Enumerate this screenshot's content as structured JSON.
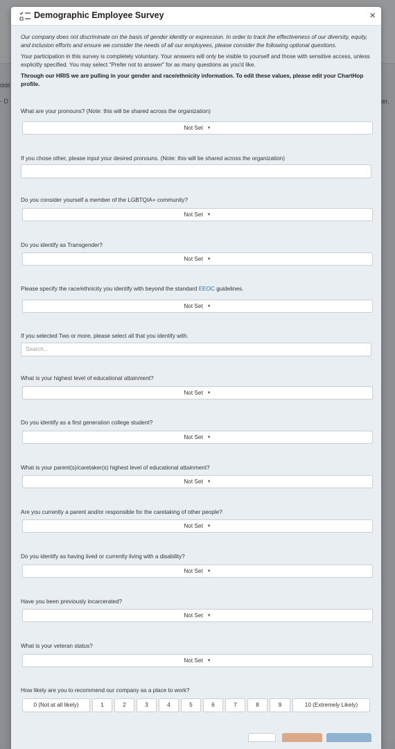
{
  "background": {
    "left_text_1": "ddit",
    "left_text_2": "- D",
    "right_text": "aker,"
  },
  "modal": {
    "title": "Demographic Employee Survey",
    "close_symbol": "×",
    "title_icon": "checklist-icon"
  },
  "intro": {
    "paragraph1": "Our company does not discriminate on the basis of gender identity or expression. In order to track the effectiveness of our diversity, equity, and inclusion efforts and ensure we consider the needs of all our employees, please consider the following optional questions.",
    "paragraph2": "Your participation in this survey is completely voluntary. Your answers will only be visible to yourself and those with sensitive access, unless explicitly specified. You may select \"Prefer not to answer\" for as many questions as you'd like.",
    "paragraph3": "Through our HRIS we are pulling in your gender and race/ethnicity information. To edit these values, please edit your ChartHop profile."
  },
  "questions": {
    "pronouns": {
      "label": "What are your pronouns? (Note: this will be shared across the organization)",
      "value": "Not Set"
    },
    "pronouns_other": {
      "label": "If you chose other, please input your desired pronouns. (Note: this will be shared across the organization)",
      "value": ""
    },
    "lgbtqia": {
      "label": "Do you consider yourself a member of the LGBTQIA+ community?",
      "value": "Not Set"
    },
    "transgender": {
      "label": "Do you identify as Transgender?",
      "value": "Not Set"
    },
    "race": {
      "label_before": "Please specify the race/ethnicity you identify with beyond the standard ",
      "label_link": "EEOC",
      "label_after": " guidelines.",
      "value": "Not Set"
    },
    "two_or_more": {
      "label": "If you selected Two or more, please select all that you identify with.",
      "placeholder": "Search..."
    },
    "education": {
      "label": "What is your highest level of educational attainment?",
      "value": "Not Set"
    },
    "first_gen": {
      "label": "Do you identify as a first generation college student?",
      "value": "Not Set"
    },
    "parent_education": {
      "label": "What is your parent(s)/caretaker(s) highest level of educational attainment?",
      "value": "Not Set"
    },
    "caretaker": {
      "label": "Are you currently a parent and/or responsible for the caretaking of other people?",
      "value": "Not Set"
    },
    "disability": {
      "label": "Do you identify as having lived or currently living with a disability?",
      "value": "Not Set"
    },
    "incarcerated": {
      "label": "Have you been previously incarcerated?",
      "value": "Not Set"
    },
    "veteran": {
      "label": "What is your veteran status?",
      "value": "Not Set"
    },
    "recommend": {
      "label": "How likely are you to recommend our company as a place to work?",
      "options": [
        "0 (Not at all likely)",
        "1",
        "2",
        "3",
        "4",
        "5",
        "6",
        "7",
        "8",
        "9",
        "10 (Extremely Likely)"
      ]
    }
  },
  "colors": {
    "link": "#2f6fad",
    "footer_secondary": "#d9a98a",
    "footer_primary": "#8fb3d0"
  }
}
